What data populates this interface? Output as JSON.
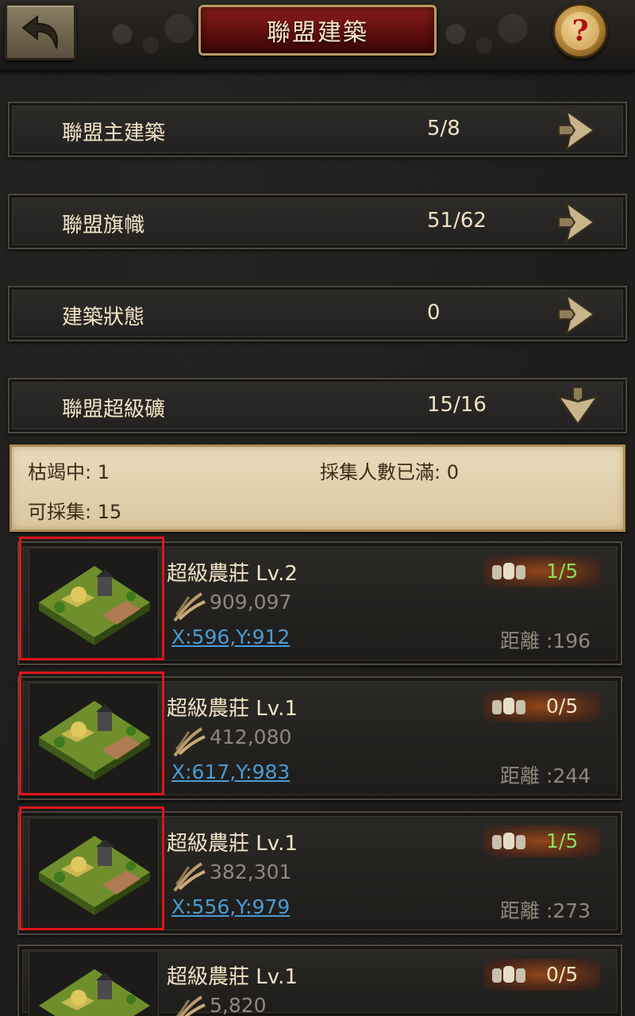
{
  "header": {
    "title": "聯盟建築",
    "help_symbol": "?"
  },
  "categories": [
    {
      "label": "聯盟主建築",
      "count": "5/8",
      "expanded": false
    },
    {
      "label": "聯盟旗幟",
      "count": "51/62",
      "expanded": false
    },
    {
      "label": "建築狀態",
      "count": "0",
      "expanded": false
    },
    {
      "label": "聯盟超級礦",
      "count": "15/16",
      "expanded": true
    }
  ],
  "summary": {
    "depleting": "枯竭中: 1",
    "full": "採集人數已滿: 0",
    "gatherable": "可採集: 15"
  },
  "mines": [
    {
      "name": "超級農莊 Lv.2",
      "amount": "909,097",
      "coords": "X:596,Y:912",
      "occupancy": "1/5",
      "distance": "距離 :196",
      "active": true
    },
    {
      "name": "超級農莊 Lv.1",
      "amount": "412,080",
      "coords": "X:617,Y:983",
      "occupancy": "0/5",
      "distance": "距離 :244",
      "active": false
    },
    {
      "name": "超級農莊 Lv.1",
      "amount": "382,301",
      "coords": "X:556,Y:979",
      "occupancy": "1/5",
      "distance": "距離 :273",
      "active": true
    },
    {
      "name": "超級農莊 Lv.1",
      "amount": "5,820",
      "coords": "",
      "occupancy": "0/5",
      "distance": "",
      "active": false
    }
  ],
  "colors": {
    "accent_red": "#e0141a",
    "link_blue": "#4a9bd3",
    "active_green": "#8be05a"
  }
}
